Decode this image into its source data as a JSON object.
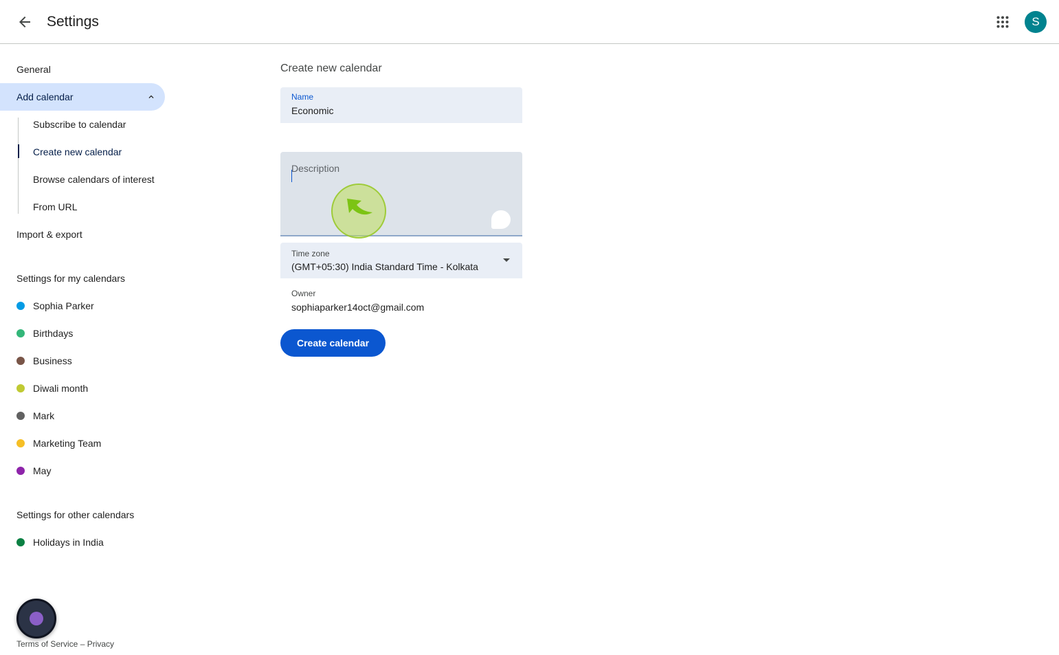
{
  "header": {
    "title": "Settings",
    "back_icon": "arrow-back-icon",
    "apps_icon": "apps-grid-icon",
    "avatar_initial": "S",
    "avatar_color": "#00838f"
  },
  "sidebar": {
    "general": "General",
    "add_calendar": "Add calendar",
    "add_calendar_sub": [
      "Subscribe to calendar",
      "Create new calendar",
      "Browse calendars of interest",
      "From URL"
    ],
    "import_export": "Import & export",
    "my_calendars_heading": "Settings for my calendars",
    "my_calendars": [
      {
        "name": "Sophia Parker",
        "color": "#039be5"
      },
      {
        "name": "Birthdays",
        "color": "#33b679"
      },
      {
        "name": "Business",
        "color": "#795548"
      },
      {
        "name": "Diwali month",
        "color": "#c0ca33"
      },
      {
        "name": "Mark",
        "color": "#616161"
      },
      {
        "name": "Marketing Team",
        "color": "#f6bf26"
      },
      {
        "name": "May",
        "color": "#8e24aa"
      }
    ],
    "other_calendars_heading": "Settings for other calendars",
    "other_calendars": [
      {
        "name": "Holidays in India",
        "color": "#0b8043"
      }
    ],
    "footer": {
      "terms": "Terms of Service",
      "separator": " – ",
      "privacy": "Privacy"
    }
  },
  "form": {
    "title": "Create new calendar",
    "name_label": "Name",
    "name_value": "Economic",
    "description_placeholder": "Description",
    "timezone_label": "Time zone",
    "timezone_value": "(GMT+05:30) India Standard Time - Kolkata",
    "owner_label": "Owner",
    "owner_value": "sophiaparker14oct@gmail.com",
    "submit_label": "Create calendar"
  },
  "colors": {
    "accent": "#0b57d0",
    "active_nav_bg": "#d3e3fd"
  }
}
